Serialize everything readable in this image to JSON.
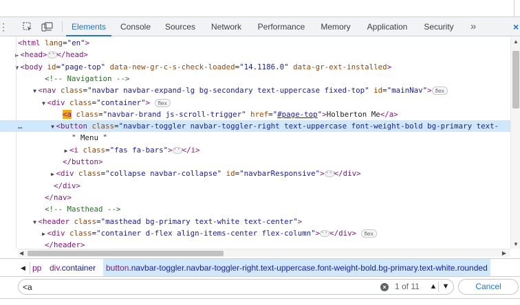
{
  "toolbar": {
    "tabs": [
      "Elements",
      "Console",
      "Sources",
      "Network",
      "Performance",
      "Memory",
      "Application",
      "Security"
    ],
    "more": "»",
    "cut_icon": "×",
    "inspect_icon": "element-picker-icon",
    "device_icon": "device-toolbar-icon"
  },
  "dom_tree": {
    "line0": {
      "open": "<html",
      "a": "lang",
      "v": "\"en\"",
      "close": ">"
    },
    "line1": {
      "open": "<head>",
      "close": "</head>"
    },
    "line2": {
      "open": "<body",
      "a1": "id",
      "v1": "\"page-top\"",
      "a2": "data-new-gr-c-s-check-loaded",
      "v2": "\"14.1186.0\"",
      "a3": "data-gr-ext-installed",
      "close": ">"
    },
    "line3": {
      "comment": "<!-- Navigation -->"
    },
    "line4": {
      "open": "<nav",
      "a1": "class",
      "v1": "\"navbar navbar-expand-lg bg-secondary text-uppercase fixed-top\"",
      "a2": "id",
      "v2": "\"mainNav\"",
      "close": ">",
      "badge": "flex"
    },
    "line5": {
      "open": "<div",
      "a": "class",
      "v": "\"container\"",
      "close": ">",
      "badge": "flex"
    },
    "line6": {
      "match": "<a",
      "a1": "class",
      "v1": "\"navbar-brand js-scroll-trigger\"",
      "a2": "href",
      "v2": "\"#page-top\"",
      "text": "Holberton Me",
      "close": "</a>"
    },
    "line7": {
      "open": "<button",
      "a": "class",
      "v": "\"navbar-toggler navbar-toggler-right text-uppercase font-weight-bold bg-primary text-"
    },
    "line8": {
      "text": "\" Menu \""
    },
    "line9": {
      "open": "<i",
      "a": "class",
      "v": "\"fas fa-bars\"",
      "close_open": ">",
      "close": "</i>"
    },
    "line10": {
      "close": "</button>"
    },
    "line11": {
      "open": "<div",
      "a1": "class",
      "v1": "\"collapse navbar-collapse\"",
      "a2": "id",
      "v2": "\"navbarResponsive\"",
      "close_open": ">",
      "close": "</div>"
    },
    "line12": {
      "close": "</div>"
    },
    "line13": {
      "close": "</nav>"
    },
    "line14": {
      "comment": "<!-- Masthead -->"
    },
    "line15": {
      "open": "<header",
      "a": "class",
      "v": "\"masthead bg-primary text-white text-center\"",
      "close": ">"
    },
    "line16": {
      "open": "<div",
      "a": "class",
      "v": "\"container d-flex align-items-center flex-column\"",
      "close_open": ">",
      "close": "</div>",
      "badge": "flex"
    },
    "line17": {
      "close": "</header>"
    },
    "selected_marker": "…"
  },
  "breadcrumbs": {
    "prev": "◀",
    "items": [
      {
        "tag": "",
        "cls": "pp"
      },
      {
        "tag": "div",
        "cls": ".container"
      },
      {
        "tag": "button",
        "cls": ".navbar-toggler.navbar-toggler-right.text-uppercase.font-weight-bold.bg-primary.text-white.rounded"
      }
    ]
  },
  "search": {
    "value": "<a",
    "clear": "×",
    "count": "1 of 11",
    "prev": "▲",
    "next": "▼",
    "cancel": "Cancel"
  },
  "colors": {
    "accent": "#1a73e8",
    "selected_row": "#cfe8fc",
    "tag": "#881280",
    "attr_name": "#994500",
    "attr_value": "#1a1aa6",
    "comment": "#236e25",
    "match_highlight": "#f9ab00"
  }
}
